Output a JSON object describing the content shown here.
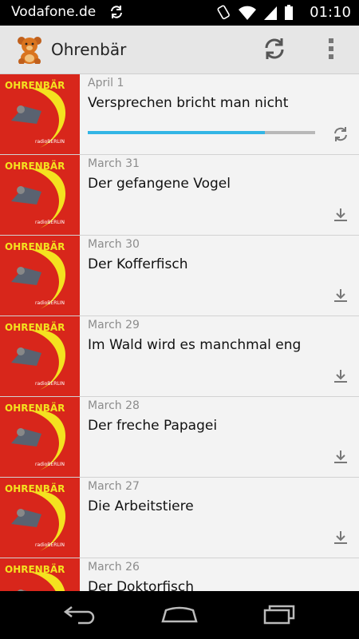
{
  "status_bar": {
    "carrier": "Vodafone.de",
    "time": "01:10",
    "icons": [
      "sync-icon",
      "rotation-lock-icon",
      "wifi-icon",
      "signal-icon",
      "battery-icon"
    ]
  },
  "action_bar": {
    "title": "Ohrenbär",
    "icon": "teddy-bear-icon",
    "actions": [
      "refresh-icon",
      "overflow-menu-icon"
    ]
  },
  "episodes": [
    {
      "date": "April 1",
      "title": "Versprechen bricht man nicht",
      "state": "downloading",
      "progress": 0.78,
      "action_icon": "refresh-icon"
    },
    {
      "date": "March 31",
      "title": "Der gefangene Vogel",
      "state": "available",
      "action_icon": "download-icon"
    },
    {
      "date": "March 30",
      "title": "Der Kofferfisch",
      "state": "available",
      "action_icon": "download-icon"
    },
    {
      "date": "March 29",
      "title": "Im Wald wird es manchmal eng",
      "state": "available",
      "action_icon": "download-icon"
    },
    {
      "date": "March 28",
      "title": "Der freche Papagei",
      "state": "available",
      "action_icon": "download-icon"
    },
    {
      "date": "March 27",
      "title": "Die Arbeitstiere",
      "state": "available",
      "action_icon": "download-icon"
    },
    {
      "date": "March 26",
      "title": "Der Doktorfisch",
      "state": "available",
      "action_icon": "download-icon"
    }
  ],
  "thumbnail": {
    "logo_text": "OHRENBÄR",
    "station_text": "radioBERLIN"
  },
  "nav_bar": {
    "buttons": [
      "back-icon",
      "home-icon",
      "recent-apps-icon"
    ]
  },
  "colors": {
    "accent": "#33b5e5",
    "action_bar": "#e6e6e6",
    "list_bg": "#f3f3f3",
    "thumbnail_red": "#d8261b",
    "thumbnail_yellow": "#f4e21f"
  }
}
